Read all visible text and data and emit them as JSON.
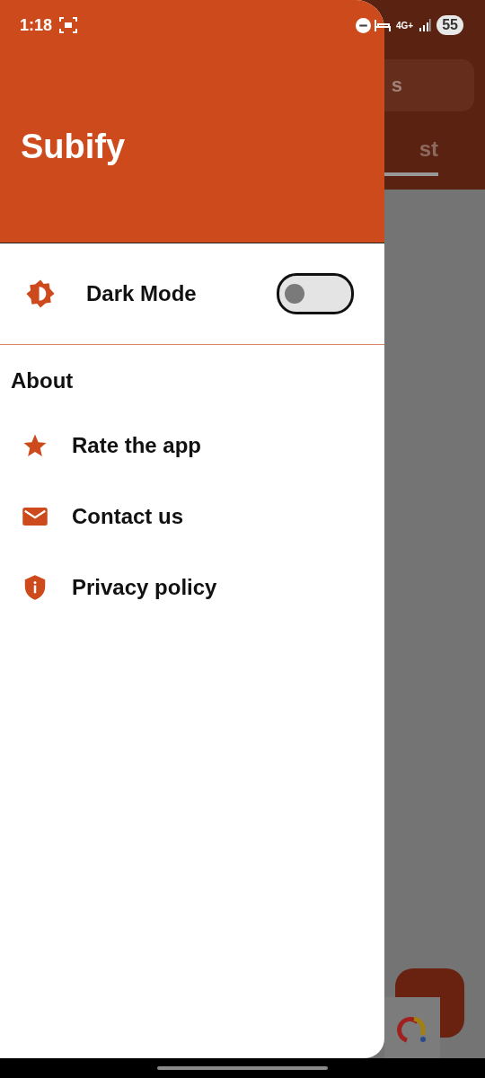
{
  "status_bar": {
    "time": "1:18",
    "network": "4G+",
    "battery": "55"
  },
  "background_app": {
    "search_field": {
      "value": "s"
    },
    "tab": {
      "label": "st",
      "selected": true
    }
  },
  "drawer": {
    "title": "Subify",
    "dark_mode": {
      "label": "Dark Mode",
      "on": false
    },
    "section": "About",
    "items": [
      {
        "kind": "star",
        "label": "Rate the app"
      },
      {
        "kind": "mail",
        "label": "Contact us"
      },
      {
        "kind": "shield",
        "label": "Privacy policy"
      }
    ]
  }
}
